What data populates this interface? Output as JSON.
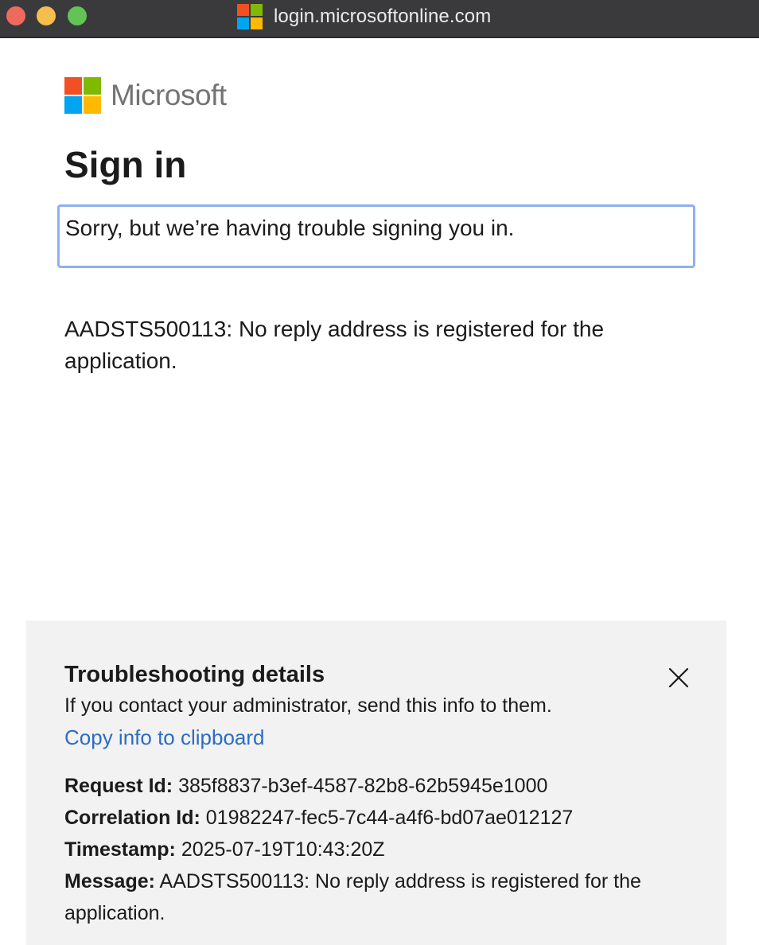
{
  "window": {
    "title": "login.microsoftonline.com",
    "favicon_colors": [
      "#f25022",
      "#7fba00",
      "#00a4ef",
      "#ffb900"
    ]
  },
  "brand": {
    "name": "Microsoft",
    "logo_colors": [
      "#f25022",
      "#7fba00",
      "#00a4ef",
      "#ffb900"
    ]
  },
  "page": {
    "title": "Sign in",
    "error_message": "Sorry, but we’re having trouble signing you in.",
    "error_code_text": "AADSTS500113: No reply address is registered for the application."
  },
  "troubleshooting": {
    "title": "Troubleshooting details",
    "description": "If you contact your administrator, send this info to them.",
    "copy_link": "Copy info to clipboard",
    "close_icon": "close-icon",
    "details": [
      {
        "label": "Request Id:",
        "value": "385f8837-b3ef-4587-82b8-62b5945e1000"
      },
      {
        "label": "Correlation Id:",
        "value": "01982247-fec5-7c44-a4f6-bd07ae012127"
      },
      {
        "label": "Timestamp:",
        "value": "2025-07-19T10:43:20Z"
      },
      {
        "label": "Message:",
        "value": "AADSTS500113: No reply address is registered for the application."
      }
    ]
  },
  "colors": {
    "link": "#2b6cc4",
    "focus_border": "#8fb0f0",
    "panel_bg": "#f2f2f2",
    "titlebar_bg": "#3a3a3c"
  }
}
